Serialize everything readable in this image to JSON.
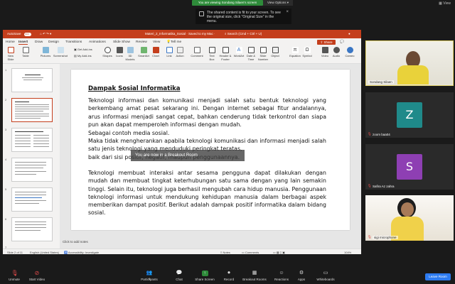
{
  "zoom": {
    "viewing_label": "You are viewing Sondang Silaen's screen",
    "view_options_label": "View Options ▾",
    "view_label": "View",
    "tooltip_text": "The shared content is fit to your screen. To see the original size, click \"Original Size\" in the menu.",
    "breakout_banner": "You are now in a Breakout Room",
    "toolbar": {
      "unmute": "Unmute",
      "start_video": "Start Video",
      "participants": "Participants",
      "participants_count": "6",
      "chat": "Chat",
      "share_screen": "Share Screen",
      "record": "Record",
      "breakout_rooms": "Breakout Rooms",
      "reactions": "Reactions",
      "apps": "Apps",
      "whiteboards": "Whiteboards",
      "leave_room": "Leave Room"
    },
    "participants": [
      {
        "name": "Sondang Silaen",
        "type": "video",
        "active": true
      },
      {
        "name": "zoom baa04",
        "type": "avatar",
        "letter": "Z",
        "color": "#1f8a8a"
      },
      {
        "name": "Safira Az zahra",
        "type": "avatar",
        "letter": "S",
        "color": "#8e3fb3"
      },
      {
        "name": "sigi microphone",
        "type": "video",
        "active": false
      }
    ]
  },
  "ppt": {
    "autosave": "AutoSave",
    "autosave_state": "OFF",
    "doc_title": "Materi_2_Informatika_Sosial · Saved to my Mac ·",
    "search": "Search (Cmd + Ctrl + U)",
    "menu": [
      "Home",
      "Insert",
      "Draw",
      "Design",
      "Transitions",
      "Animations",
      "Slide Show",
      "Review",
      "View",
      "Tell me"
    ],
    "active_menu": "Insert",
    "share": "Share",
    "ribbon": [
      "New Slide",
      "Table",
      "Pictures",
      "Screenshot",
      "Get Add-ins",
      "My Add-ins",
      "Shapes",
      "Icons",
      "3D Models",
      "SmartArt",
      "Chart",
      "Link",
      "Action",
      "Comment",
      "Text Box",
      "Header & Footer",
      "WordArt",
      "Date & Time",
      "Slide Number",
      "Object",
      "Equation",
      "Symbol",
      "Video",
      "Audio",
      "Cameo"
    ],
    "thumbnail_count": 7,
    "selected_slide": 2,
    "notes_prompt": "Click to add notes",
    "status": {
      "slide_of": "Slide 2 of 11",
      "language": "English (United States)",
      "accessibility": "Accessibility: Investigate",
      "notes": "Notes",
      "comments": "Comments",
      "zoom": "104%"
    },
    "slide": {
      "title": "Dampak Sosial Informatika",
      "paragraph1": "Teknologi informasi dan komunikasi menjadi salah satu bentuk teknologi yang berkembang amat pesat sekarang ini. Dengan internet sebagai fitur andalannya, arus informasi menjadi sangat cepat, bahkan cenderung tidak terkontrol dan siapa pun akan dapat memperoleh informasi dengan mudah.",
      "line_contoh": "Sebagai contoh media sosial.",
      "paragraph2": "Maka tidak mengherankan apabila teknologi komunikasi dan informasi menjadi salah satu jenis teknologi yang menduduki peringkat teratas,",
      "paragraph2b": "baik dari sisi positif, negatif, maupun penggunaannya.",
      "paragraph3": "Teknologi membuat interaksi antar sesama pengguna dapat dilakukan dengan mudah dan membuat tingkat keterhubungan satu sama dengan yang lain semakin tinggi. Selain itu, teknologi juga berhasil mengubah cara hidup manusia. Penggunaan teknologi informasi untuk mendukung kehidupan manusia dalam berbagai aspek memberikan dampat positif. Berikut adalah dampak positif informatika dalam bidang sosial."
    }
  }
}
